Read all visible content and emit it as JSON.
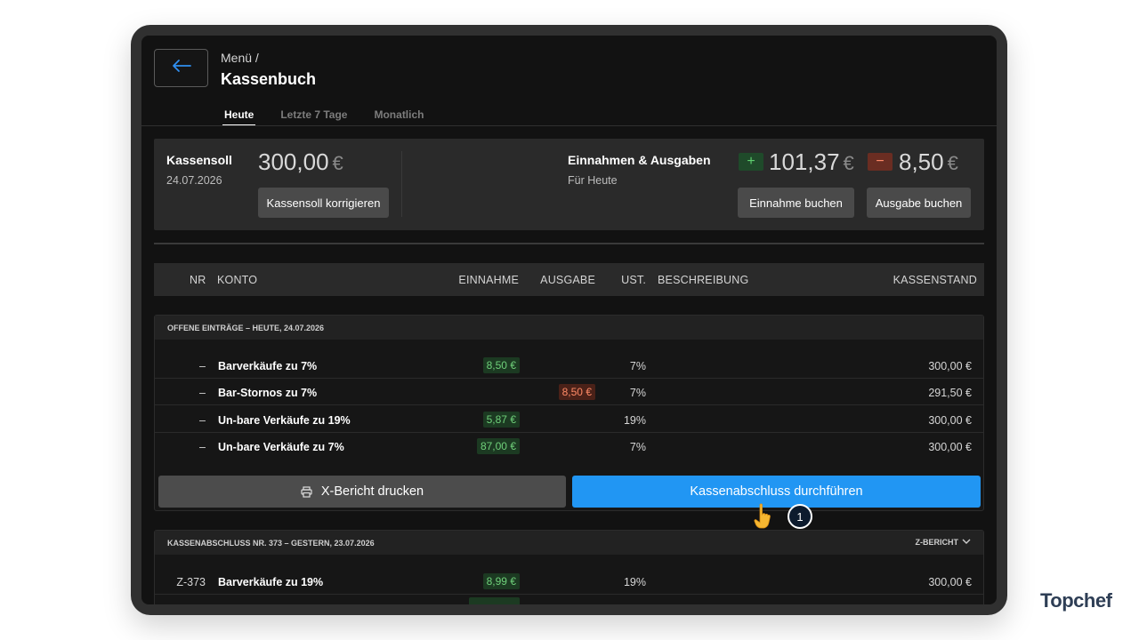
{
  "header": {
    "breadcrumb": "Menü /",
    "title": "Kassenbuch"
  },
  "tabs": [
    {
      "label": "Heute",
      "active": true
    },
    {
      "label": "Letzte 7 Tage",
      "active": false
    },
    {
      "label": "Monatlich",
      "active": false
    }
  ],
  "summary": {
    "kassensoll_label": "Kassensoll",
    "kassensoll_date": "24.07.2026",
    "kassensoll_amount": "300,00",
    "currency": "€",
    "correct_button": "Kassensoll korrigieren",
    "io_label": "Einnahmen & Ausgaben",
    "io_sub": "Für Heute",
    "plus_sign": "+",
    "minus_sign": "−",
    "income_amount": "101,37",
    "expense_amount": "8,50",
    "income_button": "Einnahme buchen",
    "expense_button": "Ausgabe buchen"
  },
  "table_headers": {
    "nr": "NR",
    "konto": "KONTO",
    "einnahme": "EINNAHME",
    "ausgabe": "AUSGABE",
    "ust": "UST.",
    "beschreibung": "BESCHREIBUNG",
    "kassenstand": "KASSENSTAND"
  },
  "open_entries": {
    "title": "OFFENE EINTRÄGE – HEUTE, 24.07.2026",
    "rows": [
      {
        "nr": "–",
        "konto": "Barverkäufe zu 7%",
        "einnahme": "8,50 €",
        "ausgabe": "",
        "ust": "7%",
        "kassenstand": "300,00 €"
      },
      {
        "nr": "–",
        "konto": "Bar-Stornos zu 7%",
        "einnahme": "",
        "ausgabe": "8,50 €",
        "ust": "7%",
        "kassenstand": "291,50 €"
      },
      {
        "nr": "–",
        "konto": "Un-bare Verkäufe zu 19%",
        "einnahme": "5,87 €",
        "ausgabe": "",
        "ust": "19%",
        "kassenstand": "300,00 €"
      },
      {
        "nr": "–",
        "konto": "Un-bare Verkäufe zu 7%",
        "einnahme": "87,00 €",
        "ausgabe": "",
        "ust": "7%",
        "kassenstand": "300,00 €"
      }
    ],
    "x_report_button": "X-Bericht drucken",
    "close_button": "Kassenabschluss durchführen"
  },
  "closing": {
    "title": "KASSENABSCHLUSS NR. 373 – GESTERN, 23.07.2026",
    "z_link": "Z-BERICHT",
    "rows": [
      {
        "nr": "Z-373",
        "konto": "Barverkäufe zu 19%",
        "einnahme": "8,99 €",
        "ust": "19%",
        "kassenstand": "300,00 €"
      }
    ]
  },
  "annotation": {
    "step": "1"
  },
  "brand": {
    "logo": "Topchef"
  },
  "colors": {
    "accent": "#2196f3",
    "income": "#6fd07a",
    "expense": "#ff8a66",
    "logo": "#2e3e55"
  }
}
